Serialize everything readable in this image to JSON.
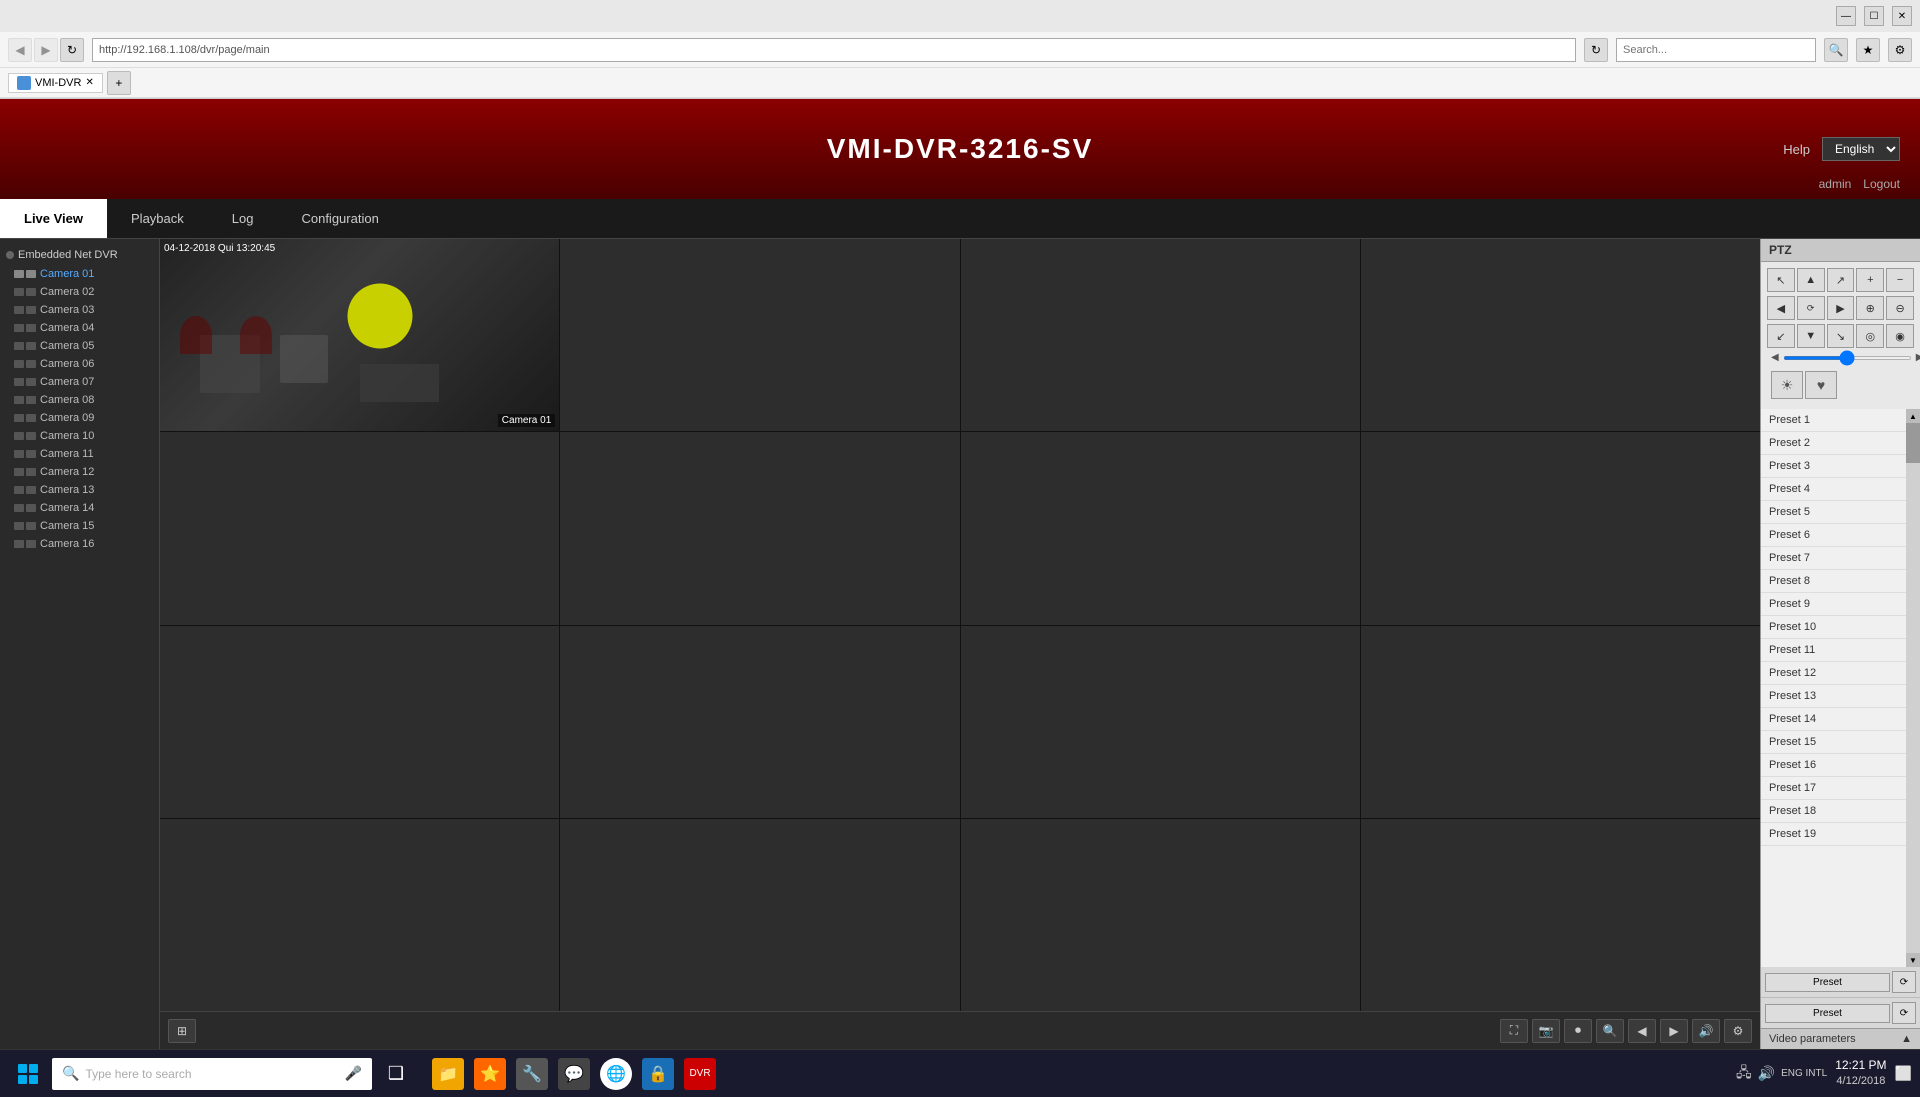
{
  "browser": {
    "address": "http://192.168.1.108/dvr/page/main",
    "search_placeholder": "Search...",
    "title_bar_buttons": [
      "—",
      "☐",
      "✕"
    ]
  },
  "app": {
    "title": "VMI-DVR-3216-SV",
    "header": {
      "help_label": "Help",
      "language": "English",
      "admin_label": "admin",
      "logout_label": "Logout"
    },
    "nav": {
      "tabs": [
        "Live View",
        "Playback",
        "Log",
        "Configuration"
      ]
    },
    "sidebar": {
      "group_label": "Embedded Net DVR",
      "cameras": [
        "Camera 01",
        "Camera 02",
        "Camera 03",
        "Camera 04",
        "Camera 05",
        "Camera 06",
        "Camera 07",
        "Camera 08",
        "Camera 09",
        "Camera 10",
        "Camera 11",
        "Camera 12",
        "Camera 13",
        "Camera 14",
        "Camera 15",
        "Camera 16"
      ]
    },
    "ptz": {
      "label": "PTZ",
      "buttons": {
        "up": "▲",
        "down": "▼",
        "left": "◀",
        "right": "▶",
        "up_left": "↖",
        "up_right": "↗",
        "down_left": "↙",
        "down_right": "↘",
        "zoom_in": "+",
        "zoom_out": "−",
        "focus_near": "⊕",
        "focus_far": "⊖",
        "iris_open": "◎",
        "iris_close": "◉",
        "auto": "⟳",
        "stop": "⏹"
      }
    },
    "presets": [
      "Preset 1",
      "Preset 2",
      "Preset 3",
      "Preset 4",
      "Preset 5",
      "Preset 6",
      "Preset 7",
      "Preset 8",
      "Preset 9",
      "Preset 10",
      "Preset 11",
      "Preset 12",
      "Preset 13",
      "Preset 14",
      "Preset 15",
      "Preset 16",
      "Preset 17",
      "Preset 18",
      "Preset 19"
    ],
    "video_params_label": "Video parameters",
    "camera_grid": {
      "timestamp": "04-12-2018 Qui 13:20:45",
      "camera_label": "Camera 01",
      "rows": 4,
      "cols": 4
    }
  },
  "taskbar": {
    "search_placeholder": "Type here to search",
    "time": "12:21 PM",
    "date": "4/12/2018",
    "language": "ENG INTL",
    "apps": [
      "⊞",
      "🔍",
      "❑",
      "📁",
      "⭐",
      "🔧",
      "💬",
      "🌐",
      "🔒",
      "🌀"
    ]
  }
}
